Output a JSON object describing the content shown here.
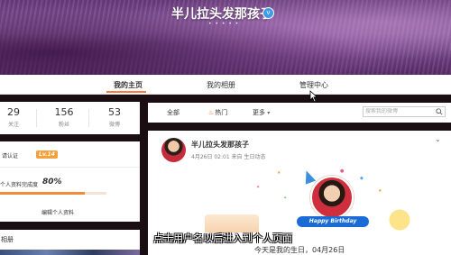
{
  "banner": {
    "username": "半儿拉头发那孩子",
    "verify_badge": "v",
    "dots": "• • • • •"
  },
  "nav": {
    "tabs": [
      {
        "label": "我的主页",
        "active": true
      },
      {
        "label": "我的相册",
        "active": false
      },
      {
        "label": "管理中心",
        "active": false
      }
    ]
  },
  "stats": [
    {
      "value": "29",
      "label": "关注"
    },
    {
      "value": "156",
      "label": "粉丝"
    },
    {
      "value": "53",
      "label": "微博"
    }
  ],
  "left_card": {
    "verify_label": "请认证",
    "level_badge": "Lv.14",
    "profile_label": "个人资料完成度",
    "profile_percent": "80%",
    "profile_fraction": 0.8,
    "edit_profile": "编辑个人资料"
  },
  "album": {
    "title": "相册"
  },
  "filter_bar": {
    "all": "全部",
    "hot": "热门",
    "more": "更多",
    "more_arrow": "▾",
    "search_placeholder": "搜索我的微博"
  },
  "post": {
    "author": "半儿拉头发那孩子",
    "meta": "4月26日 02:01 来自 生日动态",
    "birthday_banner": "Happy Birthday"
  },
  "subtitles": {
    "line1": "点击用户名以后进入到个人页面",
    "line2": "今天是我的生日，04月26日"
  },
  "colors": {
    "accent": "#fa7d3c",
    "progress": "#f08c36",
    "level_badge": "#f7a13c",
    "banner_blue": "#1b6bd6"
  }
}
